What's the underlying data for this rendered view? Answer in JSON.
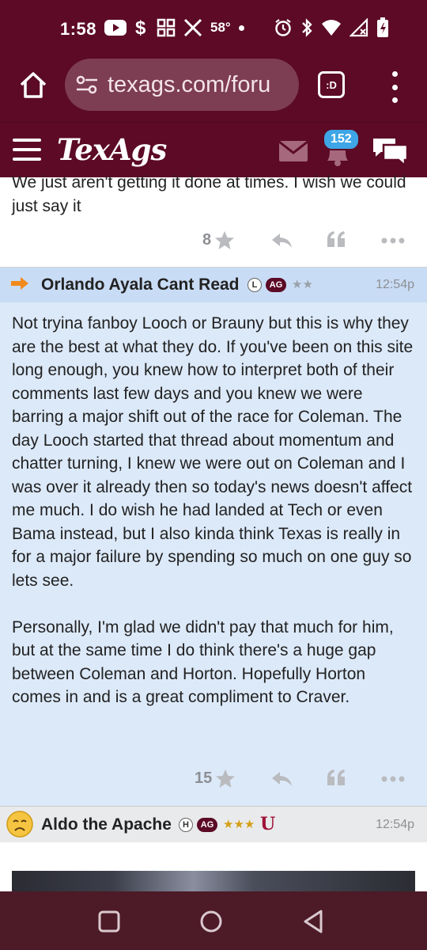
{
  "status_bar": {
    "time": "1:58",
    "temperature": "58°",
    "icons": [
      "youtube-icon",
      "dollar-icon",
      "grid-app-icon",
      "x-icon",
      "dot-icon",
      "alarm-icon",
      "bluetooth-icon",
      "wifi-icon",
      "signal-icon",
      "battery-icon"
    ]
  },
  "browser": {
    "url": "texags.com/foru",
    "tabs_label": ":D"
  },
  "site": {
    "logo": "TexAgs",
    "notification_count": "152",
    "colors": {
      "brand": "#5c0a25",
      "badge": "#3ea6e6",
      "highlight_post": "#dce9f9",
      "highlight_header": "#c9dcf5"
    }
  },
  "posts": [
    {
      "text": "We just aren't getting it done at times. I wish we could just say it",
      "star_count": "8"
    },
    {
      "username": "Orlando Ayala Cant Read",
      "badge_letter": "L",
      "ag_badge": "AG",
      "stars": "★★",
      "time": "12:54p",
      "paragraphs": [
        "Not tryina fanboy Looch or Brauny but this is why they are the best at what they do. If you've been on this site long enough, you knew how to interpret both of their comments last few days and you knew we were barring a major shift out of the race for Coleman. The day Looch started that thread about momentum and chatter turning, I knew we were out on Coleman and I was over it already then so today's news doesn't affect me much. I do wish he had landed at Tech or even Bama instead, but I also kinda think Texas is really in for a major failure by spending so much on one guy so lets see.",
        "Personally, I'm glad we didn't pay that much for him, but at the same time I do think there's a huge gap between Coleman and Horton. Hopefully Horton comes in and is a great compliment to Craver."
      ],
      "star_count": "15"
    },
    {
      "username": "Aldo the Apache",
      "badge_letter": "H",
      "ag_badge": "AG",
      "stars": "★★★",
      "extra_badge": "U",
      "time": "12:54p"
    }
  ]
}
